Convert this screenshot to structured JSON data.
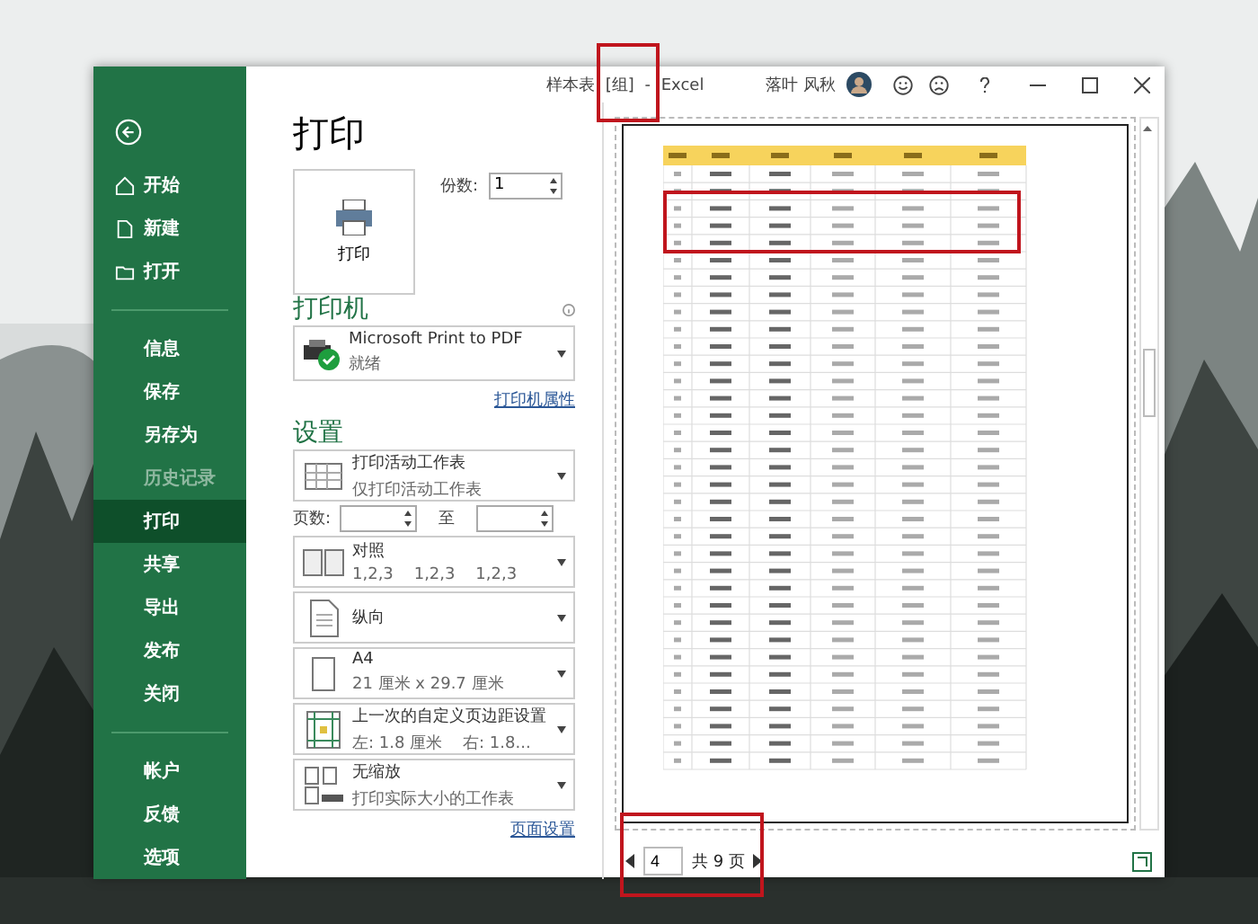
{
  "window": {
    "title": "样本表 [组] - Excel",
    "user": "落叶 风秋"
  },
  "sidebar": {
    "groups": [
      [
        {
          "label": "开始",
          "kind": "home",
          "selected": false,
          "disabled": false
        },
        {
          "label": "新建",
          "kind": "new",
          "selected": false,
          "disabled": false
        },
        {
          "label": "打开",
          "kind": "open",
          "selected": false,
          "disabled": false
        }
      ],
      [
        {
          "label": "信息",
          "selected": false,
          "disabled": false
        },
        {
          "label": "保存",
          "selected": false,
          "disabled": false
        },
        {
          "label": "另存为",
          "selected": false,
          "disabled": false
        },
        {
          "label": "历史记录",
          "selected": false,
          "disabled": true
        },
        {
          "label": "打印",
          "selected": true,
          "disabled": false
        },
        {
          "label": "共享",
          "selected": false,
          "disabled": false
        },
        {
          "label": "导出",
          "selected": false,
          "disabled": false
        },
        {
          "label": "发布",
          "selected": false,
          "disabled": false
        },
        {
          "label": "关闭",
          "selected": false,
          "disabled": false
        }
      ],
      [
        {
          "label": "帐户",
          "selected": false,
          "disabled": false
        },
        {
          "label": "反馈",
          "selected": false,
          "disabled": false
        },
        {
          "label": "选项",
          "selected": false,
          "disabled": false
        }
      ]
    ]
  },
  "print": {
    "heading": "打印",
    "button": "打印",
    "copies_label": "份数:",
    "copies": "1"
  },
  "printer": {
    "heading": "打印机",
    "name": "Microsoft Print to PDF",
    "status": "就绪",
    "link": "打印机属性"
  },
  "settings": {
    "heading": "设置",
    "pages_label": "页数:",
    "to_label": "至",
    "link": "页面设置",
    "dropdowns": [
      {
        "kind": "sheet",
        "main": "打印活动工作表",
        "sub": "仅打印活动工作表"
      },
      {
        "kind": "pages"
      },
      {
        "kind": "collate",
        "main": "对照",
        "sub": "1,2,3    1,2,3    1,2,3"
      },
      {
        "kind": "portrait",
        "main": "纵向"
      },
      {
        "kind": "paper",
        "main": "A4",
        "sub": "21 厘米 x 29.7 厘米"
      },
      {
        "kind": "margins",
        "main": "上一次的自定义页边距设置",
        "sub": "左: 1.8 厘米    右: 1.8..."
      },
      {
        "kind": "scale",
        "main": "无缩放",
        "sub": "打印实际大小的工作表"
      }
    ]
  },
  "preview": {
    "page": "4",
    "total": "共 9 页"
  }
}
